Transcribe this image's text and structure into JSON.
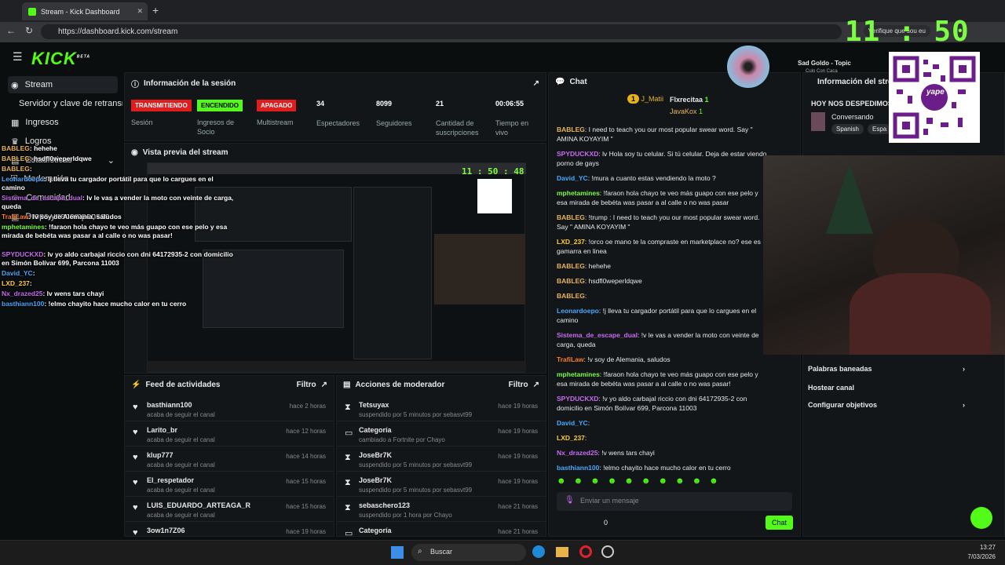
{
  "browser": {
    "tab_title": "Stream - Kick Dashboard",
    "url": "https://dashboard.kick.com/stream",
    "verify": "Verifique que sou eu",
    "chat_btn": "hat"
  },
  "clock": "11 : 50 : 48",
  "app": {
    "logo": "KICK",
    "logo_beta": "BETA"
  },
  "sidebar": {
    "items": [
      {
        "label": "Stream"
      },
      {
        "label": "Servidor y clave de retransm"
      },
      {
        "label": "Ingresos"
      },
      {
        "label": "Logros"
      },
      {
        "label": "Estadísticas"
      },
      {
        "label": "Moderación"
      },
      {
        "label": "Comunidad"
      },
      {
        "label": "Drops y recompensas"
      }
    ]
  },
  "session": {
    "title": "Información de la sesión",
    "badges": [
      {
        "text": "TRANSMITIENDO",
        "label": "Sesión",
        "color": "#e01c1c"
      },
      {
        "text": "ENCENDIDO",
        "label": "Ingresos de Socio",
        "color": "#53fc18"
      },
      {
        "text": "APAGADO",
        "label": "Multistream",
        "color": "#e01c1c"
      }
    ],
    "stats": [
      {
        "value": "34",
        "label": "Espectadores"
      },
      {
        "value": "8099",
        "label": "Seguidores"
      },
      {
        "value": "21",
        "label": "Cantidad de suscripciones"
      },
      {
        "value": "00:06:55",
        "label": "Tiempo en vivo"
      }
    ]
  },
  "preview": {
    "title": "Vista previa del stream"
  },
  "feed": {
    "title": "Feed de actividades",
    "filter": "Filtro",
    "rows": [
      {
        "name": "basthiann100",
        "sub": "acaba de seguir el canal",
        "time": "hace 2 horas"
      },
      {
        "name": "Larito_br",
        "sub": "acaba de seguir el canal",
        "time": "hace 12 horas"
      },
      {
        "name": "klup777",
        "sub": "acaba de seguir el canal",
        "time": "hace 14 horas"
      },
      {
        "name": "El_respetador",
        "sub": "acaba de seguir el canal",
        "time": "hace 15 horas"
      },
      {
        "name": "LUIS_EDUARDO_ARTEAGA_R",
        "sub": "acaba de seguir el canal",
        "time": "hace 15 horas"
      },
      {
        "name": "3ow1n7Z06",
        "sub": "",
        "time": "hace 19 horas"
      }
    ]
  },
  "mod": {
    "title": "Acciones de moderador",
    "filter": "Filtro",
    "rows": [
      {
        "name": "Tetsuyax",
        "sub": "suspendido por 5 minutos por sebasvt99",
        "time": "hace 19 horas"
      },
      {
        "name": "Categoría",
        "sub": "cambiado a Fortnite por Chayo",
        "time": "hace 19 horas"
      },
      {
        "name": "JoseBr7K",
        "sub": "suspendido por 5 minutos por sebasvt99",
        "time": "hace 19 horas"
      },
      {
        "name": "JoseBr7K",
        "sub": "suspendido por 5 minutos por sebasvt99",
        "time": "hace 19 horas"
      },
      {
        "name": "sebaschero123",
        "sub": "suspendido por 1 hora por Chayo",
        "time": "hace 21 horas"
      },
      {
        "name": "Categoría",
        "sub": "",
        "time": "hace 21 horas"
      }
    ]
  },
  "chat": {
    "title": "Chat",
    "top1": "J_Matii",
    "top2": "Flxrecitaa",
    "top2_count": "1",
    "top3": "JavaKox",
    "top3_count": "1",
    "top1_rank": "1",
    "messages": [
      {
        "user": "BABLEG",
        "color": "#e8b45a",
        "text": "I need to teach you our most popular swear word. Say \" AMINA KOYAYIM \""
      },
      {
        "user": "SPYDUCKXD",
        "color": "#c86bf0",
        "text": "lv Hola soy tu celular. Si tú celular. Deja de estar viendo porno de gays"
      },
      {
        "user": "David_YC",
        "color": "#4aa8ff",
        "text": "!mura a cuanto estas vendiendo la moto ?"
      },
      {
        "user": "mphetamines",
        "color": "#7cfc45",
        "text": "!faraon hola chayo te veo más guapo con ese pelo y esa mirada de bebéta was pasar a al calle o no was pasar"
      },
      {
        "user": "BABLEG",
        "color": "#e8b45a",
        "text": "!trump : I need to teach you our most popular swear word. Say \" AMINA KOYAYIM \""
      },
      {
        "user": "LXD_237",
        "color": "#ffcc33",
        "text": "!orco oe mano te la compraste en marketplace no? ese es gamarra en linea"
      },
      {
        "user": "BABLEG",
        "color": "#e8b45a",
        "text": "hehehe"
      },
      {
        "user": "BABLEG",
        "color": "#e8b45a",
        "text": "hsdfl0weperldqwe"
      },
      {
        "user": "BABLEG",
        "color": "#e8b45a",
        "text": ""
      },
      {
        "user": "Leonardoepo",
        "color": "#4aa8ff",
        "text": "!j lleva tu cargador portátil para que lo cargues en el camino"
      },
      {
        "user": "Sistema_de_escape_dual",
        "color": "#c86bf0",
        "text": "!v le vas a vender la moto con veinte de carga, queda"
      },
      {
        "user": "TrafiLaw",
        "color": "#ff7a2a",
        "text": "!v soy de Alemania, saludos"
      },
      {
        "user": "mphetamines",
        "color": "#7cfc45",
        "text": "!faraon hola chayo te veo más guapo con ese pelo y esa mirada de bebéta was pasar a al calle o no was pasar!"
      },
      {
        "user": "SPYDUCKXD",
        "color": "#c86bf0",
        "text": "!v yo aldo carbajal riccio con dni 64172935-2 con domicilio en Simón Bolívar 699, Parcona 11003"
      },
      {
        "user": "David_YC",
        "color": "#4aa8ff",
        "text": ""
      },
      {
        "user": "LXD_237",
        "color": "#ffcc33",
        "text": ""
      },
      {
        "user": "Nx_drazed25",
        "color": "#c86bf0",
        "text": "!v wens tars chayi"
      },
      {
        "user": "basthiann100",
        "color": "#4aa8ff",
        "text": "!elmo chayito hace mucho calor en tu cerro"
      }
    ],
    "input_placeholder": "Enviar un mensaje",
    "count": "0",
    "send": "Chat"
  },
  "music": {
    "title": "Sad Goldo - Topic",
    "sub": "Culo Con Caca"
  },
  "info": {
    "title": "Información del stream",
    "stream_title": "HOY NOS DESPEDIMOS",
    "category": "Conversando",
    "tags": [
      "Spanish",
      "Espa"
    ],
    "menu": [
      {
        "label": "Palabras baneadas"
      },
      {
        "label": "Hostear canal"
      },
      {
        "label": "Configurar objetivos"
      }
    ]
  },
  "qr": {
    "brand": "yape"
  },
  "overlay": [
    {
      "user": "BABLEG",
      "color": "#e8b45a",
      "text": ": hehehe"
    },
    {
      "user": "BABLEG",
      "color": "#e8b45a",
      "text": ": hsdfl0weperldqwe"
    },
    {
      "user": "BABLEG",
      "color": "#e8b45a",
      "text": ":"
    },
    {
      "user": "Leonardoepo",
      "color": "#4aa8ff",
      "text": ": lj lleva tu cargador portátil para que lo cargues en el camino"
    },
    {
      "user": "Sistema_de_escape_dual",
      "color": "#c86bf0",
      "text": ": lv le vas a vender la moto con veinte de carga, queda"
    },
    {
      "user": "TrafiLaw",
      "color": "#ff7a2a",
      "text": ": lv soy de Alemania, saludos"
    },
    {
      "user": "mphetamines",
      "color": "#7cfc45",
      "text": ": !faraon hola chayo te veo más guapo con ese pelo y esa mirada de bebéta was pasar a al calle o no was pasar!"
    },
    {
      "user": "SPYDUCKXD",
      "color": "#c86bf0",
      "text": ": lv yo aldo carbajal riccio con dni 64172935-2 con domicilio en Simón Bolívar 699, Parcona 11003"
    },
    {
      "user": "David_YC",
      "color": "#4aa8ff",
      "text": ":"
    },
    {
      "user": "LXD_237",
      "color": "#ffcc33",
      "text": ":"
    },
    {
      "user": "Nx_drazed25",
      "color": "#c86bf0",
      "text": ": lv wens tars chayi"
    },
    {
      "user": "basthiann100",
      "color": "#4aa8ff",
      "text": ": !elmo chayito hace mucho calor en tu cerro"
    }
  ],
  "taskbar": {
    "search": "Buscar",
    "time": "13:27",
    "date": "7/03/2026"
  }
}
